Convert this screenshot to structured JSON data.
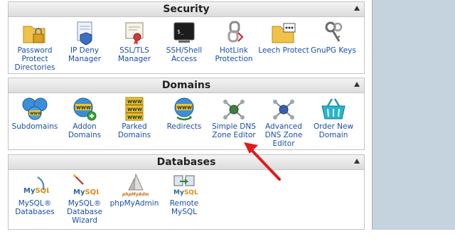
{
  "sections": {
    "security": {
      "title": "Security",
      "items": [
        {
          "label": "Password Protect Directories",
          "icon": "folder-lock-icon"
        },
        {
          "label": "IP Deny Manager",
          "icon": "document-shield-icon"
        },
        {
          "label": "SSL/TLS Manager",
          "icon": "certificate-ribbon-icon"
        },
        {
          "label": "SSH/Shell Access",
          "icon": "terminal-icon"
        },
        {
          "label": "HotLink Protection",
          "icon": "chain-link-icon"
        },
        {
          "label": "Leech Protect",
          "icon": "folder-leech-icon"
        },
        {
          "label": "GnuPG Keys",
          "icon": "keys-icon"
        }
      ]
    },
    "domains": {
      "title": "Domains",
      "items": [
        {
          "label": "Subdomains",
          "icon": "www-globes-icon"
        },
        {
          "label": "Addon Domains",
          "icon": "www-add-icon"
        },
        {
          "label": "Parked Domains",
          "icon": "www-parked-icon"
        },
        {
          "label": "Redirects",
          "icon": "www-redirect-icon"
        },
        {
          "label": "Simple DNS Zone Editor",
          "icon": "dns-network-icon"
        },
        {
          "label": "Advanced DNS Zone Editor",
          "icon": "dns-network-advanced-icon"
        },
        {
          "label": "Order New Domain",
          "icon": "shopping-basket-icon"
        }
      ]
    },
    "databases": {
      "title": "Databases",
      "items": [
        {
          "label": "MySQL® Databases",
          "icon": "mysql-dolphin-icon"
        },
        {
          "label": "MySQL® Database Wizard",
          "icon": "mysql-wizard-icon"
        },
        {
          "label": "phpMyAdmin",
          "icon": "phpmyadmin-sail-icon"
        },
        {
          "label": "Remote MySQL",
          "icon": "remote-mysql-icon"
        }
      ]
    }
  },
  "colors": {
    "link": "#1a4ea8",
    "annotation_arrow": "#e01b1b",
    "right_pane": "#c4d3de"
  }
}
